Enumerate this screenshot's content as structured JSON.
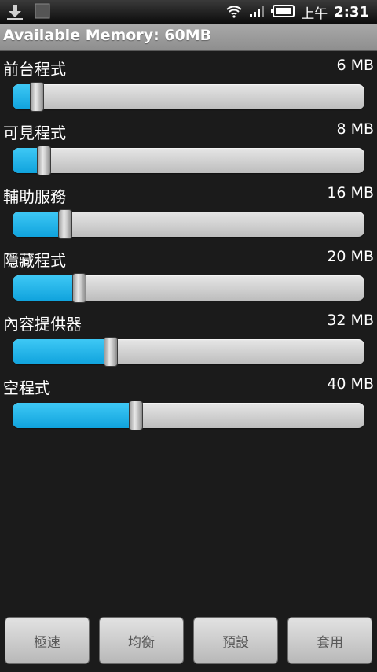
{
  "status_bar": {
    "ampm": "上午",
    "time": "2:31",
    "icons": [
      "download-icon",
      "notification-icon",
      "wifi-icon",
      "signal-icon",
      "battery-icon"
    ]
  },
  "title": "Available Memory: 60MB",
  "sliders": [
    {
      "label": "前台程式",
      "value": "6 MB",
      "level": 0.07
    },
    {
      "label": "可見程式",
      "value": "8 MB",
      "level": 0.09
    },
    {
      "label": "輔助服務",
      "value": "16 MB",
      "level": 0.15
    },
    {
      "label": "隱藏程式",
      "value": "20 MB",
      "level": 0.19
    },
    {
      "label": "內容提供器",
      "value": "32 MB",
      "level": 0.28
    },
    {
      "label": "空程式",
      "value": "40 MB",
      "level": 0.35
    }
  ],
  "buttons": {
    "extreme": "極速",
    "balanced": "均衡",
    "default": "預設",
    "apply": "套用"
  },
  "colors": {
    "accent": "#1aaee6",
    "background": "#1b1b1b"
  }
}
